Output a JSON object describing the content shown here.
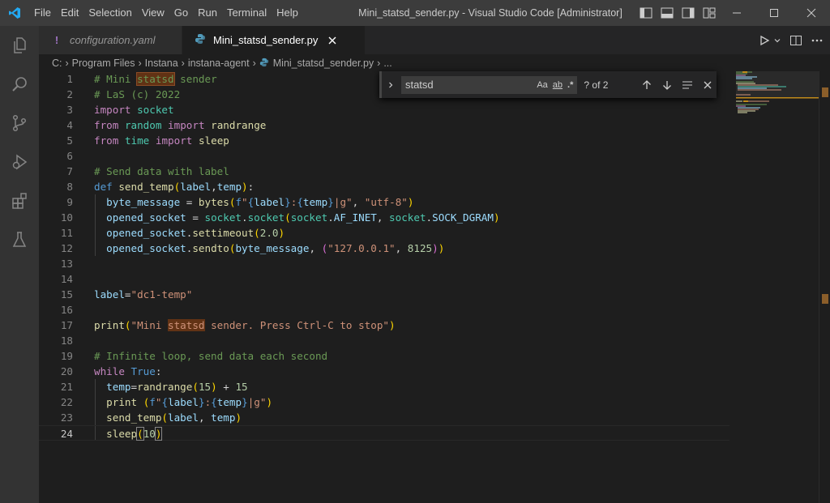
{
  "titlebar": {
    "menu": [
      "File",
      "Edit",
      "Selection",
      "View",
      "Go",
      "Run",
      "Terminal",
      "Help"
    ],
    "window_title": "Mini_statsd_sender.py - Visual Studio Code [Administrator]"
  },
  "tabs": [
    {
      "label": "configuration.yaml",
      "icon": "!"
    },
    {
      "label": "Mini_statsd_sender.py",
      "icon": "python-icon"
    }
  ],
  "breadcrumb": [
    "C:",
    "Program Files",
    "Instana",
    "instana-agent",
    "Mini_statsd_sender.py",
    "..."
  ],
  "find": {
    "query": "statsd",
    "opt_case": "Aa",
    "opt_word": "ab",
    "opt_regex": ".*",
    "count": "? of 2"
  },
  "code": {
    "line_numbers": [
      "1",
      "2",
      "3",
      "4",
      "5",
      "6",
      "7",
      "8",
      "9",
      "10",
      "11",
      "12",
      "13",
      "14",
      "15",
      "16",
      "17",
      "18",
      "19",
      "20",
      "21",
      "22",
      "23",
      "24"
    ],
    "current_line": 24,
    "lines": [
      [
        [
          "cm",
          "# Mini "
        ],
        [
          "cm hl-cur",
          "statsd"
        ],
        [
          "cm",
          " sender"
        ]
      ],
      [
        [
          "cm",
          "# LaS (c) 2022"
        ]
      ],
      [
        [
          "kw",
          "import"
        ],
        [
          "tx",
          " "
        ],
        [
          "cl",
          "socket"
        ]
      ],
      [
        [
          "kw",
          "from"
        ],
        [
          "tx",
          " "
        ],
        [
          "cl",
          "random"
        ],
        [
          "tx",
          " "
        ],
        [
          "kw",
          "import"
        ],
        [
          "tx",
          " "
        ],
        [
          "fn",
          "randrange"
        ]
      ],
      [
        [
          "kw",
          "from"
        ],
        [
          "tx",
          " "
        ],
        [
          "cl",
          "time"
        ],
        [
          "tx",
          " "
        ],
        [
          "kw",
          "import"
        ],
        [
          "tx",
          " "
        ],
        [
          "fn",
          "sleep"
        ]
      ],
      [],
      [
        [
          "cm",
          "# Send data with label"
        ]
      ],
      [
        [
          "bl",
          "def"
        ],
        [
          "tx",
          " "
        ],
        [
          "fn",
          "send_temp"
        ],
        [
          "br1",
          "("
        ],
        [
          "va",
          "label"
        ],
        [
          "tx",
          ","
        ],
        [
          "va",
          "temp"
        ],
        [
          "br1",
          ")"
        ],
        [
          "tx",
          ":"
        ]
      ],
      [
        [
          "tx",
          "  "
        ],
        [
          "va",
          "byte_message"
        ],
        [
          "tx",
          " = "
        ],
        [
          "fn",
          "bytes"
        ],
        [
          "br1",
          "("
        ],
        [
          "bl",
          "f"
        ],
        [
          "st",
          "\""
        ],
        [
          "bl",
          "{"
        ],
        [
          "va",
          "label"
        ],
        [
          "bl",
          "}"
        ],
        [
          "st",
          ":"
        ],
        [
          "bl",
          "{"
        ],
        [
          "va",
          "temp"
        ],
        [
          "bl",
          "}"
        ],
        [
          "st",
          "|g\""
        ],
        [
          "tx",
          ", "
        ],
        [
          "st",
          "\"utf-8\""
        ],
        [
          "br1",
          ")"
        ]
      ],
      [
        [
          "tx",
          "  "
        ],
        [
          "va",
          "opened_socket"
        ],
        [
          "tx",
          " = "
        ],
        [
          "cl",
          "socket"
        ],
        [
          "tx",
          "."
        ],
        [
          "cl",
          "socket"
        ],
        [
          "br1",
          "("
        ],
        [
          "cl",
          "socket"
        ],
        [
          "tx",
          "."
        ],
        [
          "va",
          "AF_INET"
        ],
        [
          "tx",
          ", "
        ],
        [
          "cl",
          "socket"
        ],
        [
          "tx",
          "."
        ],
        [
          "va",
          "SOCK_DGRAM"
        ],
        [
          "br1",
          ")"
        ]
      ],
      [
        [
          "tx",
          "  "
        ],
        [
          "va",
          "opened_socket"
        ],
        [
          "tx",
          "."
        ],
        [
          "fn",
          "settimeout"
        ],
        [
          "br1",
          "("
        ],
        [
          "nu",
          "2.0"
        ],
        [
          "br1",
          ")"
        ]
      ],
      [
        [
          "tx",
          "  "
        ],
        [
          "va",
          "opened_socket"
        ],
        [
          "tx",
          "."
        ],
        [
          "fn",
          "sendto"
        ],
        [
          "br1",
          "("
        ],
        [
          "va",
          "byte_message"
        ],
        [
          "tx",
          ", "
        ],
        [
          "br2",
          "("
        ],
        [
          "st",
          "\"127.0.0.1\""
        ],
        [
          "tx",
          ", "
        ],
        [
          "nu",
          "8125"
        ],
        [
          "br2",
          ")"
        ],
        [
          "br1",
          ")"
        ]
      ],
      [],
      [],
      [
        [
          "va",
          "label"
        ],
        [
          "tx",
          "="
        ],
        [
          "st",
          "\"dc1-temp\""
        ]
      ],
      [],
      [
        [
          "fn",
          "print"
        ],
        [
          "br1",
          "("
        ],
        [
          "st",
          "\"Mini "
        ],
        [
          "st hl-oth",
          "statsd"
        ],
        [
          "st",
          " sender. Press Ctrl-C to stop\""
        ],
        [
          "br1",
          ")"
        ]
      ],
      [],
      [
        [
          "cm",
          "# Infinite loop, send data each second"
        ]
      ],
      [
        [
          "kw",
          "while"
        ],
        [
          "tx",
          " "
        ],
        [
          "bl",
          "True"
        ],
        [
          "tx",
          ":"
        ]
      ],
      [
        [
          "tx",
          "  "
        ],
        [
          "va",
          "temp"
        ],
        [
          "tx",
          "="
        ],
        [
          "fn",
          "randrange"
        ],
        [
          "br1",
          "("
        ],
        [
          "nu",
          "15"
        ],
        [
          "br1",
          ")"
        ],
        [
          "tx",
          " + "
        ],
        [
          "nu",
          "15"
        ]
      ],
      [
        [
          "tx",
          "  "
        ],
        [
          "fn",
          "print"
        ],
        [
          "tx",
          " "
        ],
        [
          "br1",
          "("
        ],
        [
          "bl",
          "f"
        ],
        [
          "st",
          "\""
        ],
        [
          "bl",
          "{"
        ],
        [
          "va",
          "label"
        ],
        [
          "bl",
          "}"
        ],
        [
          "st",
          ":"
        ],
        [
          "bl",
          "{"
        ],
        [
          "va",
          "temp"
        ],
        [
          "bl",
          "}"
        ],
        [
          "st",
          "|g\""
        ],
        [
          "br1",
          ")"
        ]
      ],
      [
        [
          "tx",
          "  "
        ],
        [
          "fn",
          "send_temp"
        ],
        [
          "br1",
          "("
        ],
        [
          "va",
          "label"
        ],
        [
          "tx",
          ", "
        ],
        [
          "va",
          "temp"
        ],
        [
          "br1",
          ")"
        ]
      ],
      [
        [
          "tx",
          "  "
        ],
        [
          "fn",
          "sleep"
        ],
        [
          "br1 bracket-match",
          "("
        ],
        [
          "nu",
          "10"
        ],
        [
          "br1 bracket-match",
          ")"
        ]
      ]
    ]
  },
  "colors": {
    "comment": "#6a9955",
    "keyword": "#c586c0",
    "string": "#ce9178",
    "function": "#dcdcaa",
    "variable": "#9cdcfe",
    "find_match": "#613214"
  }
}
